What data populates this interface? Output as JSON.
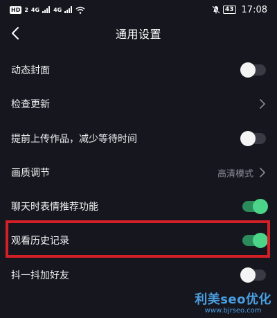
{
  "status_bar": {
    "hd_label": "HD",
    "sim_slot": "2",
    "net1": "4G",
    "net2": "4G",
    "battery": "43",
    "time": "17:08"
  },
  "header": {
    "title": "通用设置",
    "back_icon": "chevron-left-icon"
  },
  "settings": [
    {
      "label": "动态封面",
      "control": "toggle",
      "state": "off"
    },
    {
      "label": "检查更新",
      "control": "chevron"
    },
    {
      "label": "提前上传作品，减少等待时间",
      "control": "toggle",
      "state": "off"
    },
    {
      "label": "画质调节",
      "control": "value-chevron",
      "value": "高清模式"
    },
    {
      "label": "聊天时表情推荐功能",
      "control": "toggle",
      "state": "on"
    },
    {
      "label": "观看历史记录",
      "control": "toggle",
      "state": "on",
      "highlighted": true
    },
    {
      "label": "抖一抖加好友",
      "control": "toggle",
      "state": "off"
    }
  ],
  "watermark": {
    "main": "利美seo优化",
    "url": "www.bjrseo.com"
  },
  "colors": {
    "background": "#16161f",
    "toggle_on": "#4cd488",
    "highlight": "#d32027",
    "watermark": "#4a9fe0"
  }
}
